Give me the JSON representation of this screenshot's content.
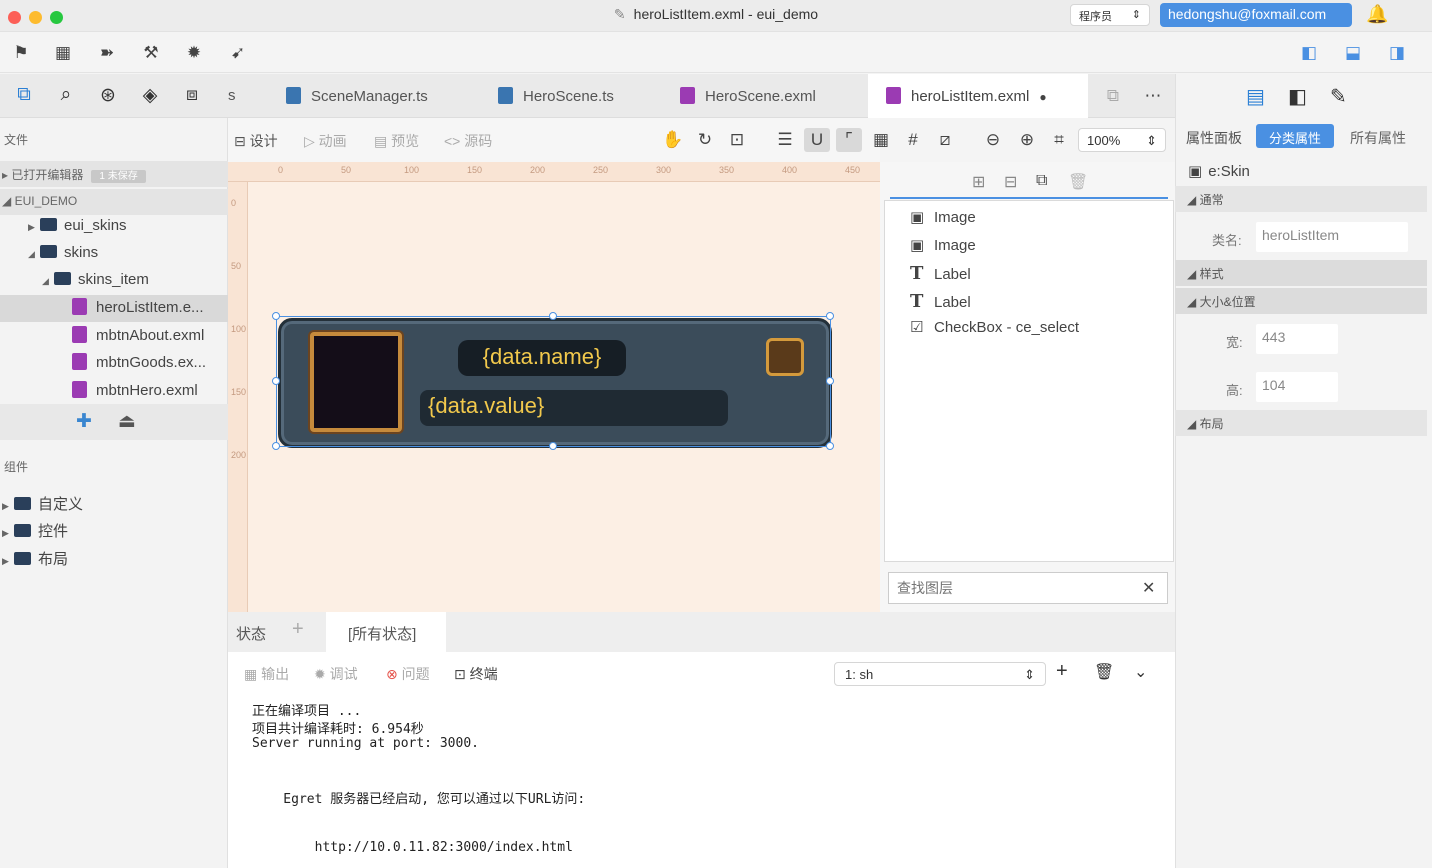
{
  "window": {
    "title": "heroListItem.exml - eui_demo",
    "role": "程序员",
    "email": "hedongshu@foxmail.com"
  },
  "tabs": [
    {
      "label": "s"
    },
    {
      "label": "SceneManager.ts"
    },
    {
      "label": "HeroScene.ts"
    },
    {
      "label": "HeroScene.exml"
    },
    {
      "label": "heroListItem.exml",
      "modified": "●"
    }
  ],
  "sidebar": {
    "files_label": "文件",
    "open_editors": {
      "label": "已打开编辑器",
      "badge": "1 未保存"
    },
    "project": "EUI_DEMO",
    "tree": [
      {
        "label": "eui_skins",
        "arrow": "▶"
      },
      {
        "label": "skins",
        "arrow": "◢"
      },
      {
        "label": "skins_item",
        "arrow": "◢"
      },
      {
        "label": "heroListItem.e..."
      },
      {
        "label": "mbtnAbout.exml"
      },
      {
        "label": "mbtnGoods.ex..."
      },
      {
        "label": "mbtnHero.exml"
      }
    ],
    "components_label": "组件",
    "components": [
      {
        "label": "自定义",
        "arrow": "▶"
      },
      {
        "label": "控件",
        "arrow": "▶"
      },
      {
        "label": "布局",
        "arrow": "▶"
      }
    ]
  },
  "editor": {
    "modes": [
      "设计",
      "动画",
      "预览",
      "源码"
    ],
    "zoom": "100%",
    "ruler_h": [
      "0",
      "50",
      "100",
      "150",
      "200",
      "250",
      "300",
      "350",
      "400",
      "450"
    ],
    "ruler_v": [
      "0",
      "50",
      "100",
      "150",
      "200"
    ],
    "skin": {
      "name": "{data.name}",
      "value": "{data.value}"
    }
  },
  "layers": {
    "items": [
      {
        "label": "Image",
        "icon": "image-icon",
        "glyph": "▣"
      },
      {
        "label": "Image",
        "icon": "image-icon",
        "glyph": "▣"
      },
      {
        "label": "Label",
        "icon": "text-icon",
        "glyph": "T"
      },
      {
        "label": "Label",
        "icon": "text-icon",
        "glyph": "T"
      },
      {
        "label": "CheckBox - ce_select",
        "icon": "checkbox-icon",
        "glyph": "☑"
      }
    ],
    "search_placeholder": "查找图层"
  },
  "properties": {
    "panel_label": "属性面板",
    "tab_category": "分类属性",
    "tab_all": "所有属性",
    "component": "e:Skin",
    "general_header": "通常",
    "class_label": "类名:",
    "class_value": "heroListItem",
    "style_header": "样式",
    "size_header": "大小&位置",
    "width_label": "宽:",
    "width_value": "443",
    "height_label": "高:",
    "height_value": "104",
    "layout_header": "布局"
  },
  "states": {
    "label": "状态",
    "add": "+",
    "all": "[所有状态]"
  },
  "console": {
    "tabs": [
      "输出",
      "调试",
      "问题",
      "终端"
    ],
    "shell": "1: sh",
    "lines": [
      "正在编译项目 ...",
      "项目共计编译耗时: 6.954秒",
      "Server running at port: 3000.",
      "    Egret 服务器已经启动, 您可以通过以下URL访问:",
      "        http://10.0.11.82:3000/index.html"
    ]
  },
  "colors": {
    "accent": "#4a90e2",
    "file_exml": "#9b3bb3",
    "canvas_bg": "#fcefe4",
    "skin_text": "#f2c94c"
  }
}
